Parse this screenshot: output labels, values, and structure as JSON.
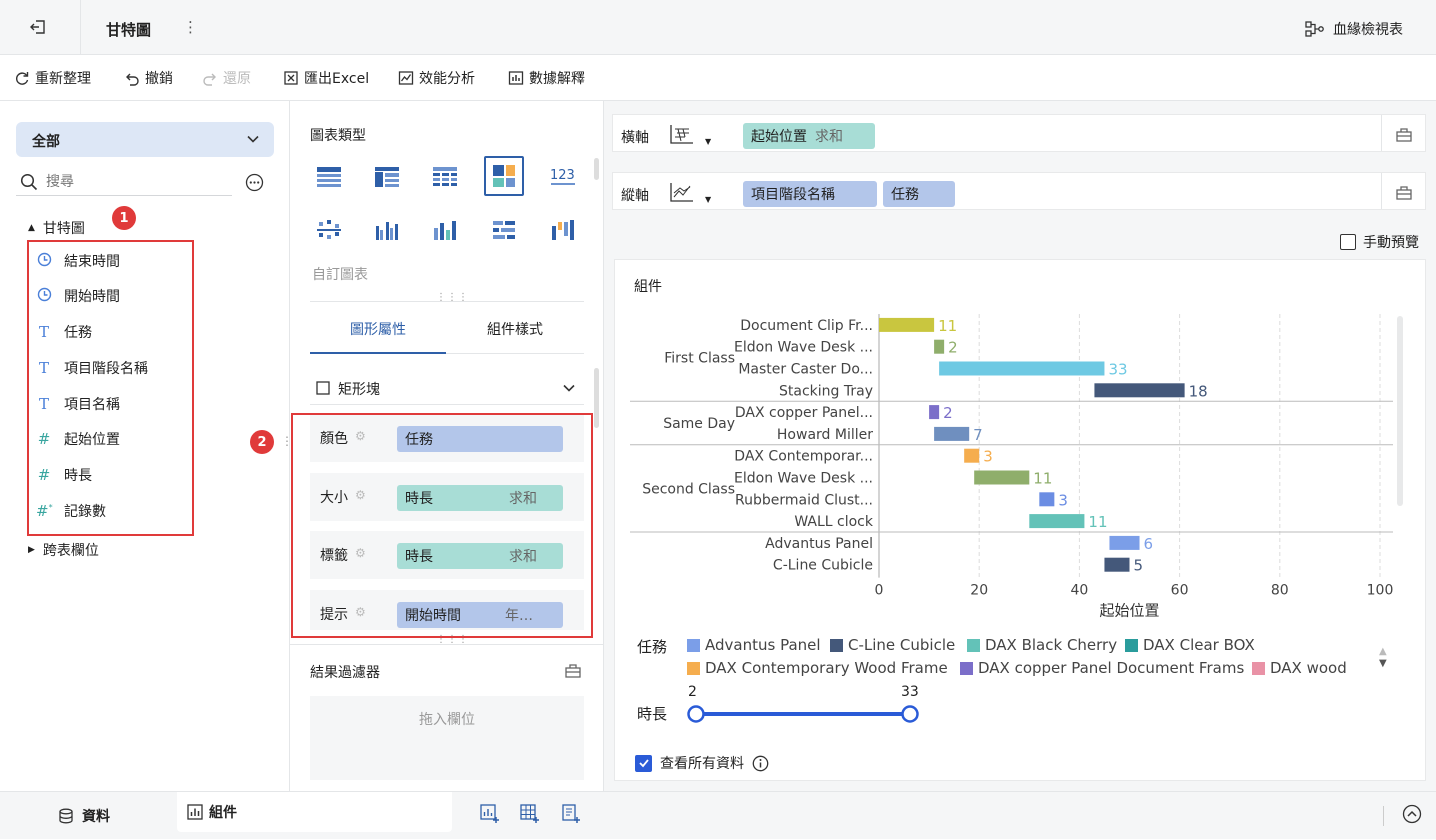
{
  "header": {
    "title": "甘特圖",
    "more": "⋮",
    "lineage_label": "血緣檢視表"
  },
  "toolbar": {
    "refresh": "重新整理",
    "undo": "撤銷",
    "redo": "還原",
    "export": "匯出Excel",
    "perf": "效能分析",
    "explain": "數據解釋"
  },
  "left": {
    "dataset_select": "全部",
    "search_placeholder": "搜尋",
    "group": "甘特圖",
    "fields": [
      {
        "icon": "clock-icon",
        "label": "結束時間"
      },
      {
        "icon": "clock-icon",
        "label": "開始時間"
      },
      {
        "icon": "text-type-icon",
        "label": "任務"
      },
      {
        "icon": "text-type-icon",
        "label": "項目階段名稱"
      },
      {
        "icon": "text-type-icon",
        "label": "項目名稱"
      },
      {
        "icon": "number-type-icon",
        "label": "起始位置"
      },
      {
        "icon": "number-type-icon",
        "label": "時長"
      },
      {
        "icon": "record-count-icon",
        "label": "記錄數"
      }
    ],
    "cross_group": "跨表欄位",
    "badge1": "1"
  },
  "mid": {
    "chart_type_title": "圖表類型",
    "custom_chart": "自訂圖表",
    "tabs": [
      "圖形屬性",
      "組件樣式"
    ],
    "mark_type": "矩形塊",
    "props": [
      {
        "label": "顏色",
        "value": "任務",
        "agg": ""
      },
      {
        "label": "大小",
        "value": "時長",
        "agg": "求和"
      },
      {
        "label": "標籤",
        "value": "時長",
        "agg": "求和"
      },
      {
        "label": "提示",
        "value": "開始時間",
        "agg": "年…"
      }
    ],
    "badge2": "2",
    "filter_title": "結果過濾器",
    "filter_drop": "拖入欄位"
  },
  "right": {
    "x_axis_label": "橫軸",
    "x_pill": {
      "value": "起始位置",
      "agg": "求和"
    },
    "y_axis_label": "縱軸",
    "y_pills": [
      "項目階段名稱",
      "任務"
    ],
    "manual_preview": "手動預覽",
    "widget_title": "組件",
    "legend_task_label": "任務",
    "legend_duration_label": "時長",
    "duration_min": "2",
    "duration_max": "33",
    "view_all": "查看所有資料"
  },
  "chart_data": {
    "type": "bar",
    "orientation": "horizontal",
    "xlabel": "起始位置",
    "xlim": [
      0,
      100
    ],
    "xticks": [
      0,
      20,
      40,
      60,
      80,
      100
    ],
    "groups": [
      {
        "name": "First Class",
        "rows": [
          {
            "label": "Document Clip Fr...",
            "start": 0,
            "duration": 11,
            "color": "#c9c63f"
          },
          {
            "label": "Eldon Wave Desk ...",
            "start": 11,
            "duration": 2,
            "color": "#8fae6b"
          },
          {
            "label": "Master Caster Do...",
            "start": 12,
            "duration": 33,
            "color": "#6ec9e3"
          },
          {
            "label": "Stacking Tray",
            "start": 43,
            "duration": 18,
            "color": "#44587a"
          }
        ]
      },
      {
        "name": "Same Day",
        "rows": [
          {
            "label": "DAX copper Panel...",
            "start": 10,
            "duration": 2,
            "color": "#7b6ec9"
          },
          {
            "label": "Howard Miller",
            "start": 11,
            "duration": 7,
            "color": "#6f8fbf"
          }
        ]
      },
      {
        "name": "Second Class",
        "rows": [
          {
            "label": "DAX Contemporar...",
            "start": 17,
            "duration": 3,
            "color": "#f5ad4e"
          },
          {
            "label": "Eldon Wave Desk ...",
            "start": 19,
            "duration": 11,
            "color": "#8fae6b"
          },
          {
            "label": "Rubbermaid Clust...",
            "start": 32,
            "duration": 3,
            "color": "#6b8de3"
          },
          {
            "label": "WALL clock",
            "start": 30,
            "duration": 11,
            "color": "#63c2b8"
          }
        ]
      },
      {
        "name": "",
        "rows": [
          {
            "label": "Advantus Panel",
            "start": 46,
            "duration": 6,
            "color": "#7b9ee8"
          },
          {
            "label": "C-Line Cubicle",
            "start": 45,
            "duration": 5,
            "color": "#44587a"
          }
        ]
      }
    ],
    "legend": [
      {
        "name": "Advantus Panel",
        "color": "#7b9ee8"
      },
      {
        "name": "C-Line Cubicle",
        "color": "#44587a"
      },
      {
        "name": "DAX Black Cherry",
        "color": "#63c2b8"
      },
      {
        "name": "DAX Clear BOX",
        "color": "#2a9c9c"
      },
      {
        "name": "DAX Contemporary Wood Frame",
        "color": "#f5ad4e"
      },
      {
        "name": "DAX copper Panel Document Frams",
        "color": "#7b6ec9"
      },
      {
        "name": "DAX wood",
        "color": "#e992a6"
      }
    ]
  },
  "bottom": {
    "data_tab": "資料",
    "widget_tab": "組件"
  }
}
